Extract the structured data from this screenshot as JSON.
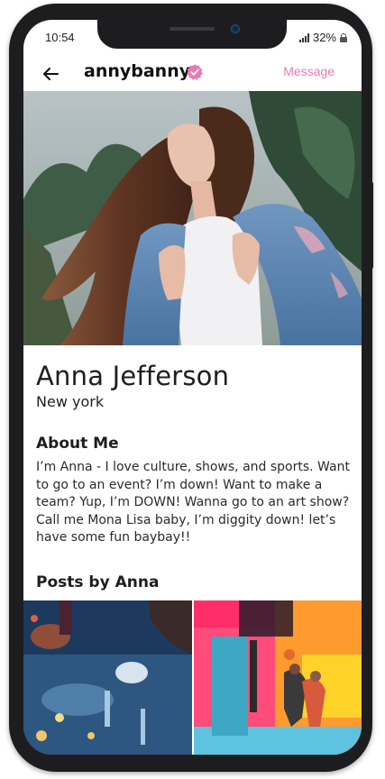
{
  "status_bar": {
    "time": "10:54",
    "battery": "32%"
  },
  "header": {
    "username": "annybanny",
    "message_label": "Message",
    "accent_color": "#e87bb2"
  },
  "profile": {
    "name": "Anna Jefferson",
    "location": "New york"
  },
  "about": {
    "title": "About Me",
    "text": "I’m Anna - I love culture, shows, and sports. Want to go to an event? I’m down! Want to make a team? Yup, I’m DOWN! Wanna go to an art show? Call me Mona Lisa baby, I’m diggity down! let’s have some fun baybay!!"
  },
  "posts": {
    "title": "Posts by Anna"
  }
}
